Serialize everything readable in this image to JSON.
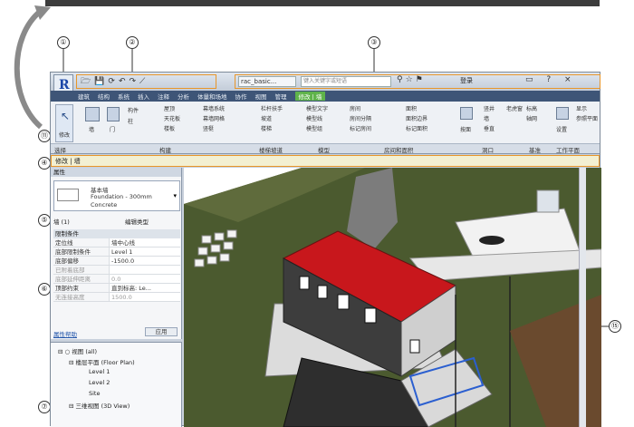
{
  "callouts": [
    "①",
    "②",
    "③",
    "④",
    "⑤",
    "⑥",
    "⑦",
    "⑪",
    "⑮"
  ],
  "app": {
    "logo": "R"
  },
  "qat": {
    "icons": [
      "open-icon",
      "save-icon",
      "sync-icon",
      "undo-icon",
      "redo-icon",
      "measure-icon"
    ],
    "glyphs": [
      "🗁",
      "💾",
      "⟳",
      "↶",
      "↷",
      "⟋"
    ]
  },
  "infocenter": {
    "doc_title": "rac_basic...",
    "search_placeholder": "键入关键字或短语",
    "login": "登录",
    "icons": "⚲☆⚑",
    "win_controls": "▭ ? ×"
  },
  "tabs": [
    "建筑",
    "结构",
    "系统",
    "插入",
    "注释",
    "分析",
    "体量和场地",
    "协作",
    "视图",
    "管理",
    "修改 | 墙"
  ],
  "ribbon": {
    "modify_label": "修改",
    "items": [
      "墙",
      "门",
      "构件",
      "柱",
      "屋顶",
      "天花板",
      "楼板",
      "幕墙系统",
      "幕墙网格",
      "竖梃",
      "栏杆扶手",
      "坡道",
      "楼梯",
      "模型文字",
      "模型线",
      "模型组",
      "房间",
      "房间分隔",
      "标记房间",
      "面积",
      "面积边界",
      "标记面积",
      "按面",
      "竖井",
      "墙",
      "垂直",
      "老虎窗",
      "标高",
      "轴网",
      "设置",
      "显示",
      "参照平面"
    ],
    "panels": [
      "选择",
      "构建",
      "楼梯坡道",
      "模型",
      "房间和面积",
      "洞口",
      "基准",
      "工作平面"
    ]
  },
  "options_bar": {
    "label": "修改 | 墙"
  },
  "properties": {
    "title": "属性",
    "type_name": "基本墙",
    "type_sub1": "Foundation - 300mm",
    "type_sub2": "Concrete",
    "instance": "墙 (1)",
    "edit_type": "编辑类型",
    "category": "限制条件",
    "rows": [
      {
        "k": "定位线",
        "v": "墙中心线",
        "dis": false
      },
      {
        "k": "底部限制条件",
        "v": "Level 1",
        "dis": false
      },
      {
        "k": "底部偏移",
        "v": "-1500.0",
        "dis": false
      },
      {
        "k": "已附着底部",
        "v": "",
        "dis": true
      },
      {
        "k": "底部延伸距离",
        "v": "0.0",
        "dis": true
      },
      {
        "k": "顶部约束",
        "v": "直到标高: Le...",
        "dis": false
      },
      {
        "k": "无连接高度",
        "v": "1500.0",
        "dis": true
      }
    ],
    "help": "属性帮助",
    "apply": "应用"
  },
  "browser": {
    "items": [
      "⊟ ○ 视图 (all)",
      "⊟ 楼层平面 (Floor Plan)",
      "Level 1",
      "Level 2",
      "Site",
      "⊟ 三维视图 (3D View)"
    ]
  },
  "colors": {
    "accent_orange": "#e8962a",
    "roof_red": "#c8171c",
    "ribbon_tab_bg": "#3e5577",
    "active_tab": "#5fb34a",
    "terrain": "#4a5a2e"
  }
}
